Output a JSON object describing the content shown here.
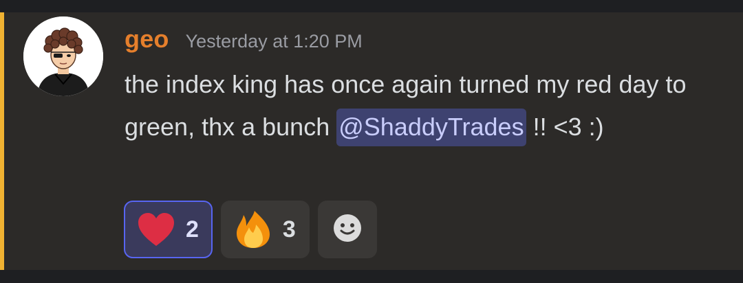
{
  "message": {
    "author": "geo",
    "timestamp": "Yesterday at 1:20 PM",
    "text_before_mention": "the index king has once again turned my red day to green, thx a bunch ",
    "mention": "@ShaddyTrades",
    "text_after_mention": " !! <3 :)",
    "colors": {
      "author": "#e57f2c",
      "accent_bar": "#f0b232",
      "mention_bg": "#3e4270",
      "mention_text": "#c9cdfb"
    }
  },
  "reactions": [
    {
      "emoji": "heart-icon",
      "count": "2",
      "active": true
    },
    {
      "emoji": "fire-icon",
      "count": "3",
      "active": false
    }
  ],
  "add_reaction": {
    "icon": "smiley-face-icon"
  }
}
